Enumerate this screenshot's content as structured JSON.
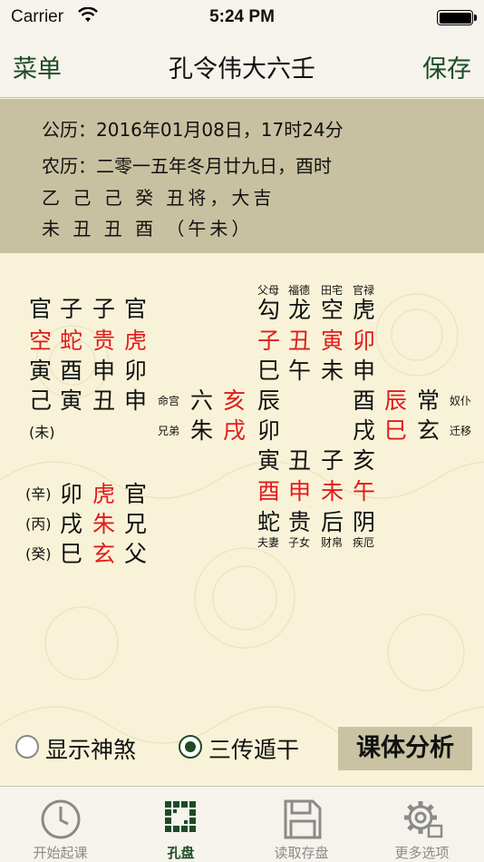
{
  "status_bar": {
    "carrier": "Carrier",
    "time": "5:24 PM"
  },
  "nav": {
    "menu": "菜单",
    "title": "孔令伟大六壬",
    "save": "保存"
  },
  "info": {
    "solar": "公历：2016年01月08日，17时24分",
    "lunar": "农历：二零一五年冬月廿九日，酉时",
    "stems_line": "乙 己 己 癸  丑将，大吉",
    "branches_line": "未 丑 丑 酉  （午未）"
  },
  "four_lessons": {
    "row1": [
      "官",
      "子",
      "子",
      "官"
    ],
    "row2": [
      "空",
      "蛇",
      "贵",
      "虎"
    ],
    "row3": [
      "寅",
      "酉",
      "申",
      "卯"
    ],
    "row4": [
      "己",
      "寅",
      "丑",
      "申"
    ],
    "wei": "(未)"
  },
  "three_transmissions": [
    {
      "gan": "(辛)",
      "branch": "卯",
      "god": "虎",
      "kin": "官"
    },
    {
      "gan": "(丙)",
      "branch": "戌",
      "god": "朱",
      "kin": "兄"
    },
    {
      "gan": "(癸)",
      "branch": "巳",
      "god": "玄",
      "kin": "父"
    }
  ],
  "plate": {
    "top_labels": [
      "父母",
      "福德",
      "田宅",
      "官禄"
    ],
    "top_gods": [
      "勾",
      "龙",
      "空",
      "虎"
    ],
    "top_heaven": [
      "子",
      "丑",
      "寅",
      "卯"
    ],
    "top_earth": [
      "巳",
      "午",
      "未",
      "申"
    ],
    "left": {
      "row1": {
        "label": "命宫",
        "god": "六",
        "heaven": "亥",
        "earth": "辰"
      },
      "row2": {
        "label": "兄弟",
        "god": "朱",
        "heaven": "戌",
        "earth": "卯"
      }
    },
    "right": {
      "row1": {
        "earth": "酉",
        "heaven": "辰",
        "god": "常",
        "label": "奴仆"
      },
      "row2": {
        "earth": "戌",
        "heaven": "巳",
        "god": "玄",
        "label": "迁移"
      }
    },
    "bottom_earth": [
      "寅",
      "丑",
      "子",
      "亥"
    ],
    "bottom_heaven": [
      "酉",
      "申",
      "未",
      "午"
    ],
    "bottom_gods": [
      "蛇",
      "贵",
      "后",
      "阴"
    ],
    "bottom_labels": [
      "夫妻",
      "子女",
      "财帛",
      "疾厄"
    ]
  },
  "options": {
    "show_shensha": "显示神煞",
    "show_shensha_checked": false,
    "sanchuan_dungan": "三传遁干",
    "sanchuan_dungan_checked": true,
    "analyze_button": "课体分析"
  },
  "tabs": [
    {
      "label": "开始起课",
      "icon": "clock-icon",
      "active": false
    },
    {
      "label": "孔盘",
      "icon": "grid-board-icon",
      "active": true
    },
    {
      "label": "读取存盘",
      "icon": "save-disk-icon",
      "active": false
    },
    {
      "label": "更多选项",
      "icon": "gear-icon",
      "active": false
    }
  ],
  "colors": {
    "accent_green": "#1d4b24",
    "red_text": "#e21b1b",
    "panel_tan": "#c8c1a1",
    "board_bg": "#f8f3d8"
  }
}
